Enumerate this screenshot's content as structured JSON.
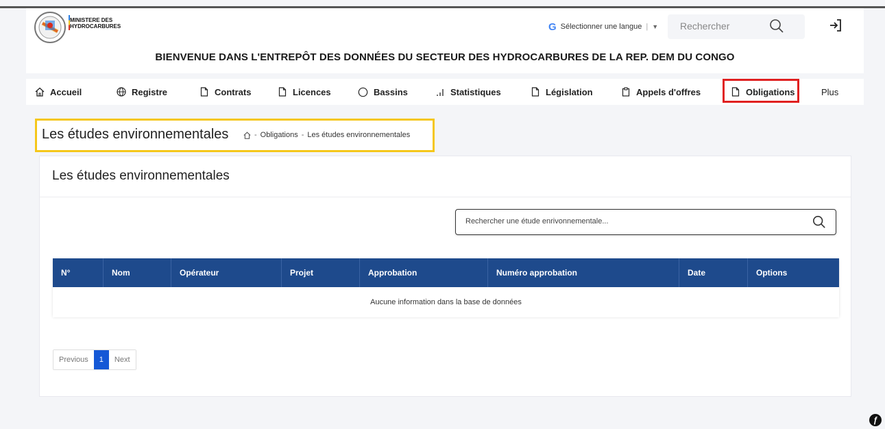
{
  "header": {
    "brand_line1": "MINISTERE DES",
    "brand_line2": "HYDROCARBURES",
    "language_label": "Sélectionner une langue",
    "search_placeholder": "Rechercher",
    "welcome": "BIENVENUE DANS L'ENTREPÔT DES DONNÉES DU SECTEUR DES HYDROCARBURES DE LA REP. DEM DU CONGO"
  },
  "nav": {
    "items": [
      {
        "label": "Accueil",
        "icon": "home-icon"
      },
      {
        "label": "Registre",
        "icon": "globe-icon"
      },
      {
        "label": "Contrats",
        "icon": "document-icon"
      },
      {
        "label": "Licences",
        "icon": "document-icon"
      },
      {
        "label": "Bassins",
        "icon": "circle-icon"
      },
      {
        "label": "Statistiques",
        "icon": "bar-chart-icon"
      },
      {
        "label": "Législation",
        "icon": "document-icon"
      },
      {
        "label": "Appels d'offres",
        "icon": "clipboard-icon"
      },
      {
        "label": "Obligations",
        "icon": "document-icon"
      },
      {
        "label": "Plus",
        "icon": ""
      }
    ],
    "active": "Obligations",
    "highlight_color": "#e02020"
  },
  "page": {
    "title": "Les études environnementales",
    "breadcrumb": [
      "Obligations",
      "Les études environnementales"
    ],
    "breadcrumb_highlight_color": "#f5c71a"
  },
  "card": {
    "title": "Les études environnementales",
    "search_placeholder": "Rechercher une étude enrivonnementale...",
    "table": {
      "headers": [
        "N°",
        "Nom",
        "Opérateur",
        "Projet",
        "Approbation",
        "Numéro approbation",
        "Date",
        "Options"
      ],
      "empty_message": "Aucune information dans la base de données",
      "header_color": "#1e4a8c"
    },
    "pagination": {
      "previous": "Previous",
      "current": "1",
      "next": "Next"
    }
  }
}
